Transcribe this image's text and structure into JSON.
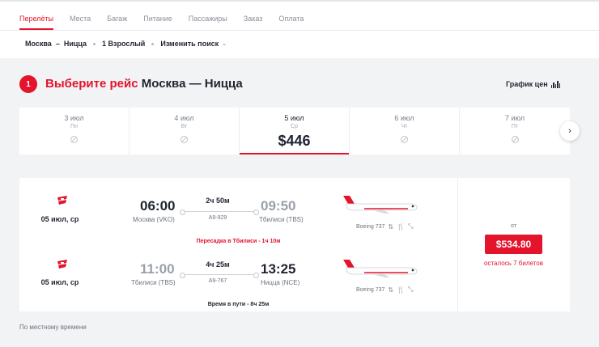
{
  "tabs": [
    "Перелёты",
    "Места",
    "Багаж",
    "Питание",
    "Пассажиры",
    "Заказ",
    "Оплата"
  ],
  "crumbs": {
    "route": "Москва",
    "dash": "–",
    "dest": "Ницца",
    "pax": "1 Взрослый",
    "edit": "Изменить поиск"
  },
  "step": "1",
  "heading": {
    "prefix": "Выберите рейс",
    "route": "Москва — Ницца"
  },
  "price_chart_label": "График цен",
  "dates": [
    {
      "date": "3 июл",
      "weekday": "Пн",
      "price": null
    },
    {
      "date": "4 июл",
      "weekday": "Вт",
      "price": null
    },
    {
      "date": "5 июл",
      "weekday": "Ср",
      "price": "$446"
    },
    {
      "date": "6 июл",
      "weekday": "Чт",
      "price": null
    },
    {
      "date": "7 июл",
      "weekday": "Пт",
      "price": null
    }
  ],
  "segments": [
    {
      "date": "05 июл, ср",
      "dep_time": "06:00",
      "dep_airport": "Москва (VKO)",
      "duration": "2ч 50м",
      "flight": "A9-929",
      "arr_time": "09:50",
      "arr_airport": "Тбилиси (TBS)",
      "aircraft": "Boeing 737"
    },
    {
      "date": "05 июл, ср",
      "dep_time": "11:00",
      "dep_airport": "Тбилиси (TBS)",
      "duration": "4ч 25м",
      "flight": "A9-767",
      "arr_time": "13:25",
      "arr_airport": "Ницца (NCE)",
      "aircraft": "Boeing 737"
    }
  ],
  "transfer": "Пересадка в Тбилиси - 1ч 10м",
  "total_time": "Время в пути - 8ч 25м",
  "offer": {
    "from": "от",
    "price": "$534.80",
    "seats_left": "осталось 7 билетов"
  },
  "footer": "По местному времени",
  "colors": {
    "accent": "#e3142c"
  }
}
